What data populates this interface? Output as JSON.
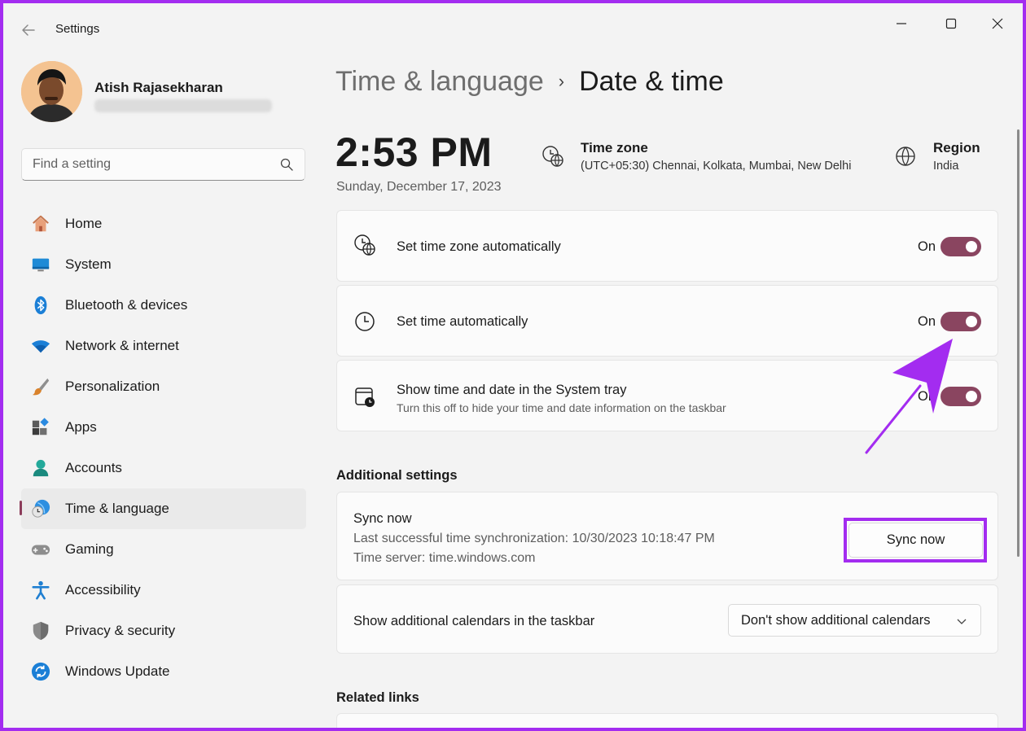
{
  "app": {
    "title": "Settings"
  },
  "profile": {
    "name": "Atish Rajasekharan"
  },
  "search": {
    "placeholder": "Find a setting"
  },
  "sidebar": {
    "items": [
      {
        "label": "Home",
        "icon": "home-icon"
      },
      {
        "label": "System",
        "icon": "system-icon"
      },
      {
        "label": "Bluetooth & devices",
        "icon": "bluetooth-icon"
      },
      {
        "label": "Network & internet",
        "icon": "wifi-icon"
      },
      {
        "label": "Personalization",
        "icon": "brush-icon"
      },
      {
        "label": "Apps",
        "icon": "apps-icon"
      },
      {
        "label": "Accounts",
        "icon": "accounts-icon"
      },
      {
        "label": "Time & language",
        "icon": "time-language-icon",
        "active": true
      },
      {
        "label": "Gaming",
        "icon": "gamepad-icon"
      },
      {
        "label": "Accessibility",
        "icon": "accessibility-icon"
      },
      {
        "label": "Privacy & security",
        "icon": "shield-icon"
      },
      {
        "label": "Windows Update",
        "icon": "update-icon"
      }
    ]
  },
  "breadcrumb": {
    "parent": "Time & language",
    "separator": "›",
    "current": "Date & time"
  },
  "clock": {
    "time": "2:53 PM",
    "date": "Sunday, December 17, 2023"
  },
  "timezone": {
    "title": "Time zone",
    "value": "(UTC+05:30) Chennai, Kolkata, Mumbai, New Delhi"
  },
  "region": {
    "title": "Region",
    "value": "India"
  },
  "settings": {
    "tz_auto": {
      "title": "Set time zone automatically",
      "state": "On"
    },
    "time_auto": {
      "title": "Set time automatically",
      "state": "On"
    },
    "tray": {
      "title": "Show time and date in the System tray",
      "subtitle": "Turn this off to hide your time and date information on the taskbar",
      "state": "On"
    }
  },
  "additional": {
    "heading": "Additional settings",
    "sync": {
      "title": "Sync now",
      "last_sync": "Last successful time synchronization: 10/30/2023 10:18:47 PM",
      "server": "Time server: time.windows.com",
      "button": "Sync now"
    },
    "calendars": {
      "title": "Show additional calendars in the taskbar",
      "selected": "Don't show additional calendars"
    }
  },
  "related": {
    "heading": "Related links"
  },
  "colors": {
    "accent": "#8a4560",
    "highlight": "#a32cf0"
  }
}
